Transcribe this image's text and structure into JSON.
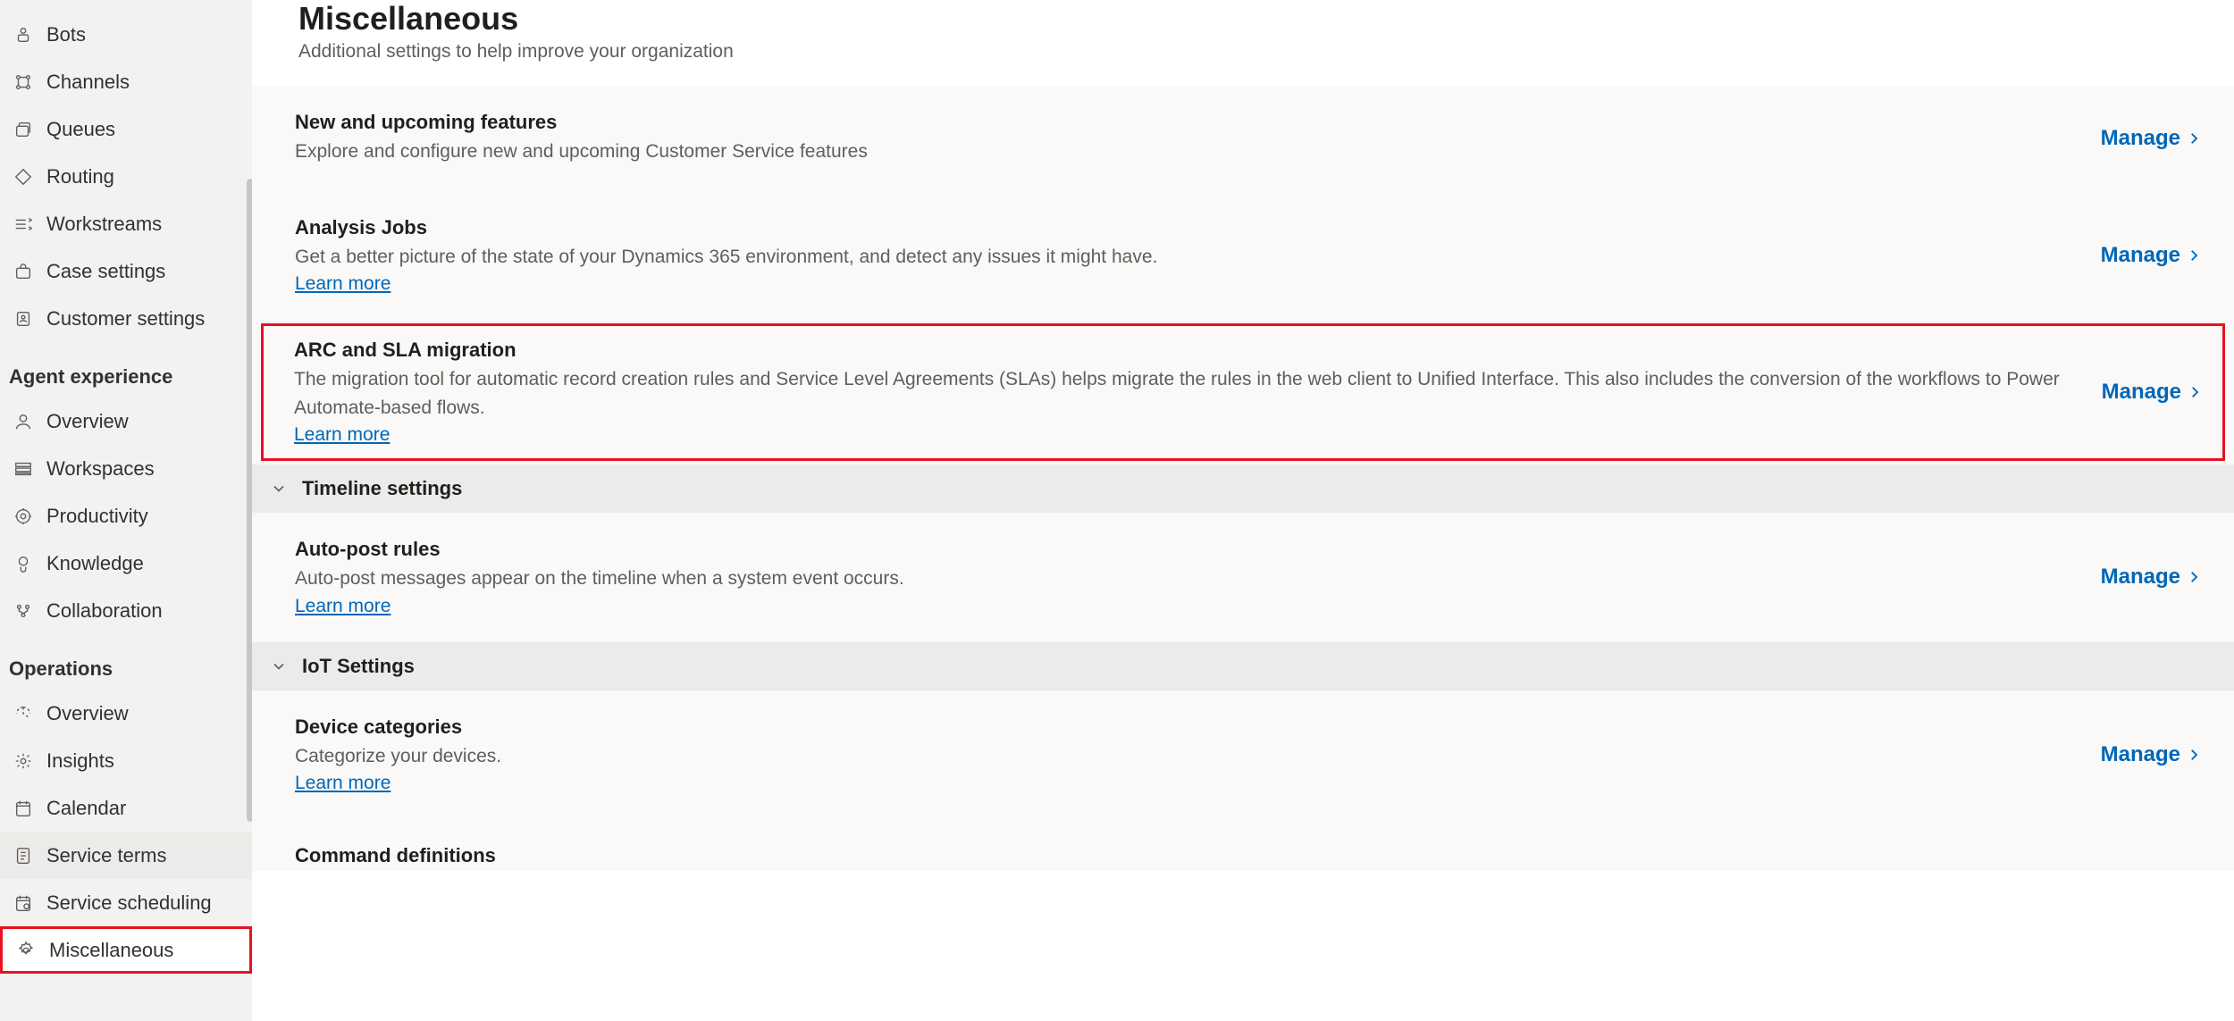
{
  "sidebar": {
    "groups": [
      {
        "heading": null,
        "items": [
          {
            "label": "Bots"
          },
          {
            "label": "Channels"
          },
          {
            "label": "Queues"
          },
          {
            "label": "Routing"
          },
          {
            "label": "Workstreams"
          },
          {
            "label": "Case settings"
          },
          {
            "label": "Customer settings"
          }
        ]
      },
      {
        "heading": "Agent experience",
        "items": [
          {
            "label": "Overview"
          },
          {
            "label": "Workspaces"
          },
          {
            "label": "Productivity"
          },
          {
            "label": "Knowledge"
          },
          {
            "label": "Collaboration"
          }
        ]
      },
      {
        "heading": "Operations",
        "items": [
          {
            "label": "Overview"
          },
          {
            "label": "Insights"
          },
          {
            "label": "Calendar"
          },
          {
            "label": "Service terms"
          },
          {
            "label": "Service scheduling"
          },
          {
            "label": "Miscellaneous"
          }
        ]
      }
    ]
  },
  "page": {
    "title": "Miscellaneous",
    "subtitle": "Additional settings to help improve your organization"
  },
  "manage_label": "Manage",
  "learn_more_label": "Learn more",
  "cards": {
    "new_features": {
      "title": "New and upcoming features",
      "desc": "Explore and configure new and upcoming Customer Service features"
    },
    "analysis_jobs": {
      "title": "Analysis Jobs",
      "desc": "Get a better picture of the state of your Dynamics 365 environment, and detect any issues it might have."
    },
    "arc_sla": {
      "title": "ARC and SLA migration",
      "desc": "The migration tool for automatic record creation rules and Service Level Agreements (SLAs) helps migrate the rules in the web client to Unified Interface. This also includes the conversion of the workflows to Power Automate-based flows."
    },
    "auto_post": {
      "title": "Auto-post rules",
      "desc": "Auto-post messages appear on the timeline when a system event occurs."
    },
    "device_categories": {
      "title": "Device categories",
      "desc": "Categorize your devices."
    },
    "command_defs": {
      "title": "Command definitions"
    }
  },
  "sections": {
    "timeline": "Timeline settings",
    "iot": "IoT Settings"
  }
}
